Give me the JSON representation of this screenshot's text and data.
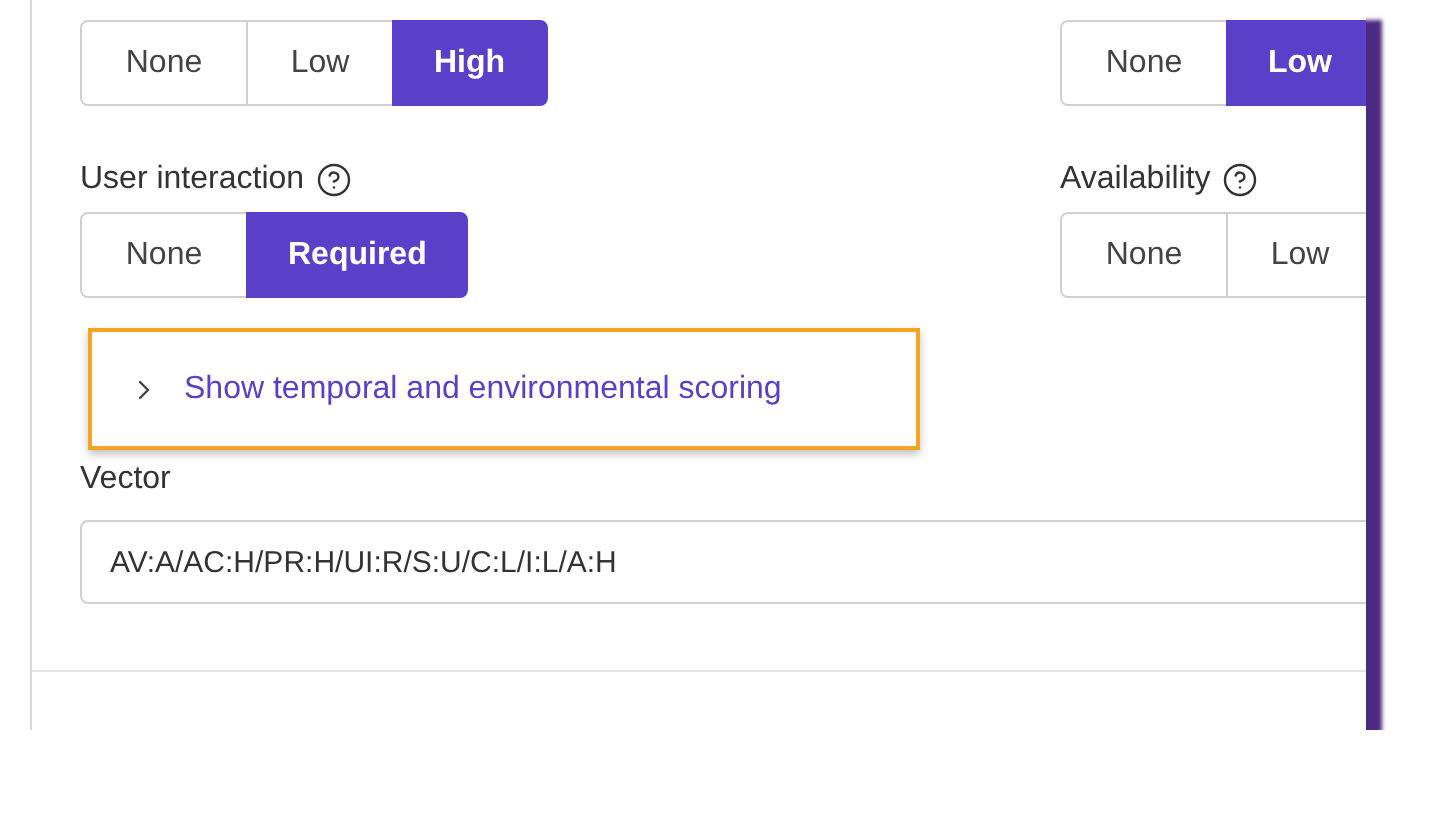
{
  "rows": [
    {
      "fields": [
        {
          "options": [
            {
              "label": "None",
              "selected": false
            },
            {
              "label": "Low",
              "selected": false
            },
            {
              "label": "High",
              "selected": true
            }
          ]
        },
        {
          "options": [
            {
              "label": "None",
              "selected": false
            },
            {
              "label": "Low",
              "selected": true
            }
          ]
        }
      ]
    },
    {
      "fields": [
        {
          "label": "User interaction",
          "options": [
            {
              "label": "None",
              "selected": false
            },
            {
              "label": "Required",
              "selected": true
            }
          ]
        },
        {
          "label": "Availability",
          "options": [
            {
              "label": "None",
              "selected": false
            },
            {
              "label": "Low",
              "selected": false
            }
          ]
        }
      ]
    }
  ],
  "expander": {
    "label": "Show temporal and environmental scoring",
    "expanded": false,
    "highlighted": true
  },
  "vector": {
    "label": "Vector",
    "value": "AV:A/AC:H/PR:H/UI:R/S:U/C:L/I:L/A:H"
  }
}
